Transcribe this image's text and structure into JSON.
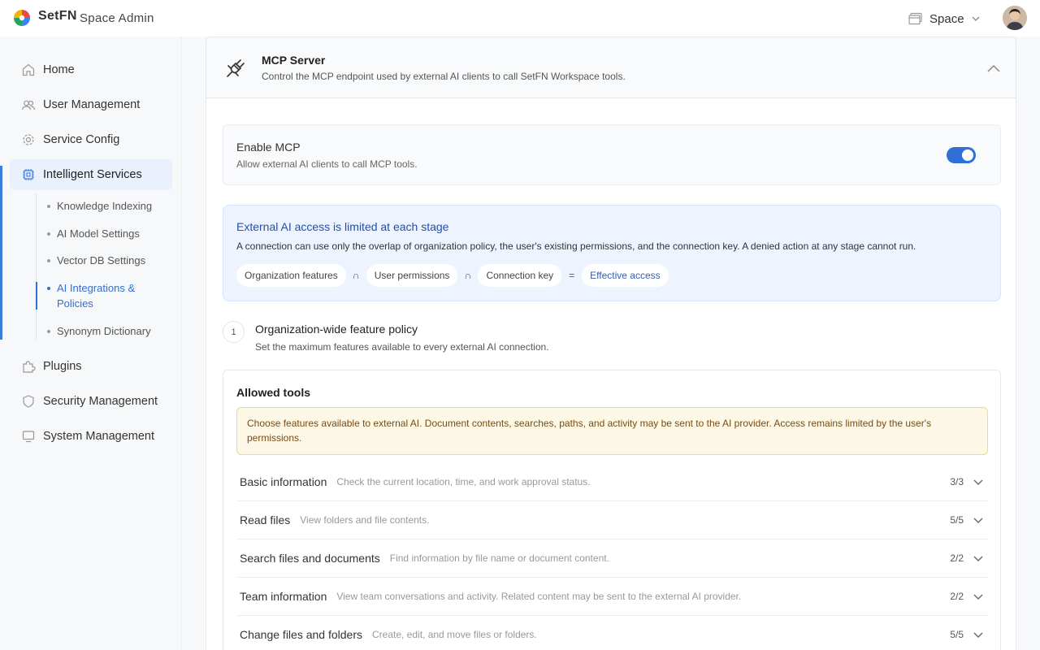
{
  "header": {
    "brand": "SetFN",
    "subtitle": "Space Admin",
    "space_label": "Space"
  },
  "sidebar": {
    "items": [
      {
        "label": "Home",
        "icon": "home-icon"
      },
      {
        "label": "User Management",
        "icon": "users-icon"
      },
      {
        "label": "Service Config",
        "icon": "gear-icon"
      },
      {
        "label": "Intelligent Services",
        "icon": "chip-icon"
      },
      {
        "label": "Plugins",
        "icon": "puzzle-icon"
      },
      {
        "label": "Security Management",
        "icon": "shield-icon"
      },
      {
        "label": "System Management",
        "icon": "monitor-icon"
      }
    ],
    "subitems": [
      {
        "label": "Knowledge Indexing"
      },
      {
        "label": "AI Model Settings"
      },
      {
        "label": "Vector DB Settings"
      },
      {
        "label": "AI Integrations & Policies"
      },
      {
        "label": "Synonym Dictionary"
      }
    ]
  },
  "mcp": {
    "title": "MCP Server",
    "description": "Control the MCP endpoint used by external AI clients to call SetFN Workspace tools.",
    "enable_title": "Enable MCP",
    "enable_desc": "Allow external AI clients to call MCP tools.",
    "enabled": true
  },
  "access_info": {
    "title": "External AI access is limited at each stage",
    "description": "A connection can use only the overlap of organization policy, the user's existing permissions, and the connection key. A denied action at any stage cannot run.",
    "chips": [
      "Organization features",
      "User permissions",
      "Connection key",
      "Effective access"
    ],
    "op_intersect": "∩",
    "op_equals": "="
  },
  "step": {
    "number": "1",
    "title": "Organization-wide feature policy",
    "description": "Set the maximum features available to every external AI connection."
  },
  "tools": {
    "title": "Allowed tools",
    "warning": "Choose features available to external AI. Document contents, searches, paths, and activity may be sent to the AI provider. Access remains limited by the user's permissions.",
    "rows": [
      {
        "name": "Basic information",
        "desc": "Check the current location, time, and work approval status.",
        "count": "3/3"
      },
      {
        "name": "Read files",
        "desc": "View folders and file contents.",
        "count": "5/5"
      },
      {
        "name": "Search files and documents",
        "desc": "Find information by file name or document content.",
        "count": "2/2"
      },
      {
        "name": "Team information",
        "desc": "View team conversations and activity. Related content may be sent to the external AI provider.",
        "count": "2/2"
      },
      {
        "name": "Change files and folders",
        "desc": "Create, edit, and move files or folders.",
        "count": "5/5"
      }
    ]
  },
  "colors": {
    "accent": "#2f6fd6",
    "info_bg": "#eef4ff",
    "warn_bg": "#fdf8e6"
  }
}
